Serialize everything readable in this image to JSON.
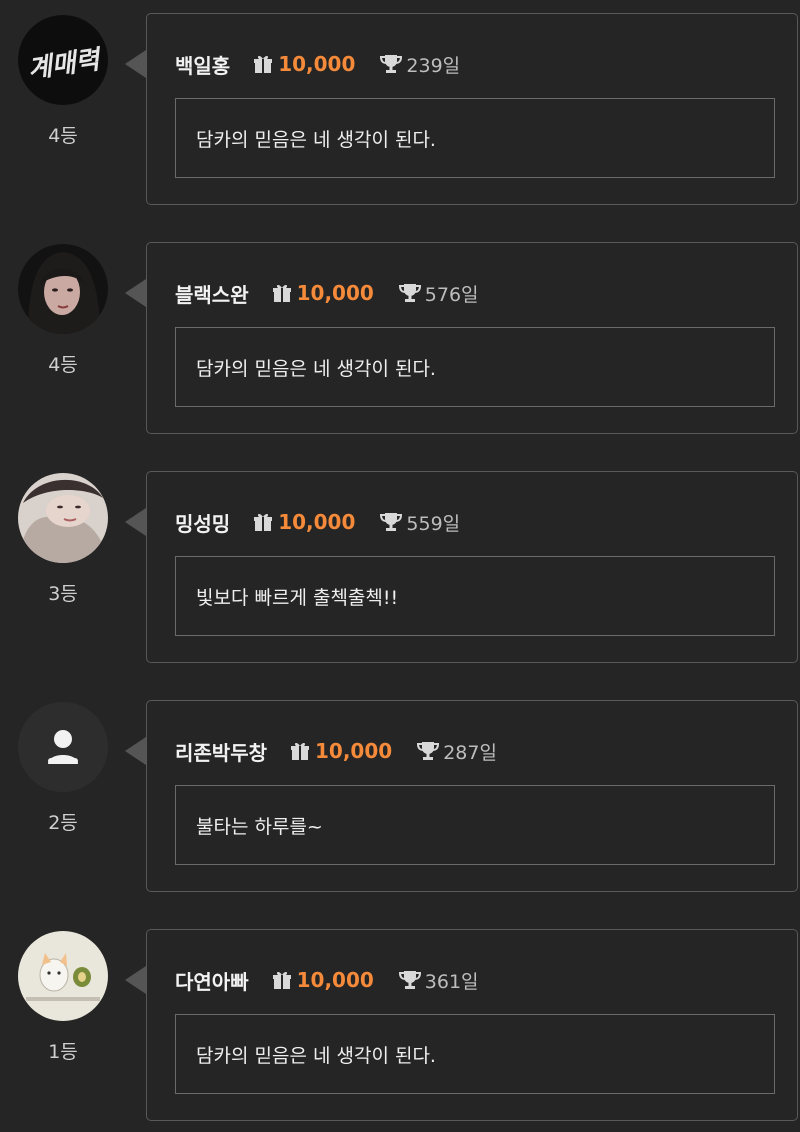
{
  "posts": [
    {
      "username": "백일홍",
      "coins": "10,000",
      "days": "239일",
      "rank": "4등",
      "message": "담카의 믿음은 네 생각이 된다.",
      "avatar": "avatar-dark-neon-text",
      "avatar_text": "계매력"
    },
    {
      "username": "블랙스완",
      "coins": "10,000",
      "days": "576일",
      "rank": "4등",
      "message": "담카의 믿음은 네 생각이 된다.",
      "avatar": "avatar-portrait-woman-dark"
    },
    {
      "username": "밍성밍",
      "coins": "10,000",
      "days": "559일",
      "rank": "3등",
      "message": "빛보다 빠르게 출첵출첵!!",
      "avatar": "avatar-portrait-woman-light"
    },
    {
      "username": "리존박두창",
      "coins": "10,000",
      "days": "287일",
      "rank": "2등",
      "message": "불타는 하루를~",
      "avatar": "default-user-icon"
    },
    {
      "username": "다연아빠",
      "coins": "10,000",
      "days": "361일",
      "rank": "1등",
      "message": "담카의 믿음은 네 생각이 된다.",
      "avatar": "avatar-cat-drawing"
    }
  ],
  "icons": {
    "gift": "gift-icon",
    "trophy": "trophy-icon"
  },
  "colors": {
    "background": "#252525",
    "coins": "#f48a3a",
    "card_border": "#585858"
  }
}
